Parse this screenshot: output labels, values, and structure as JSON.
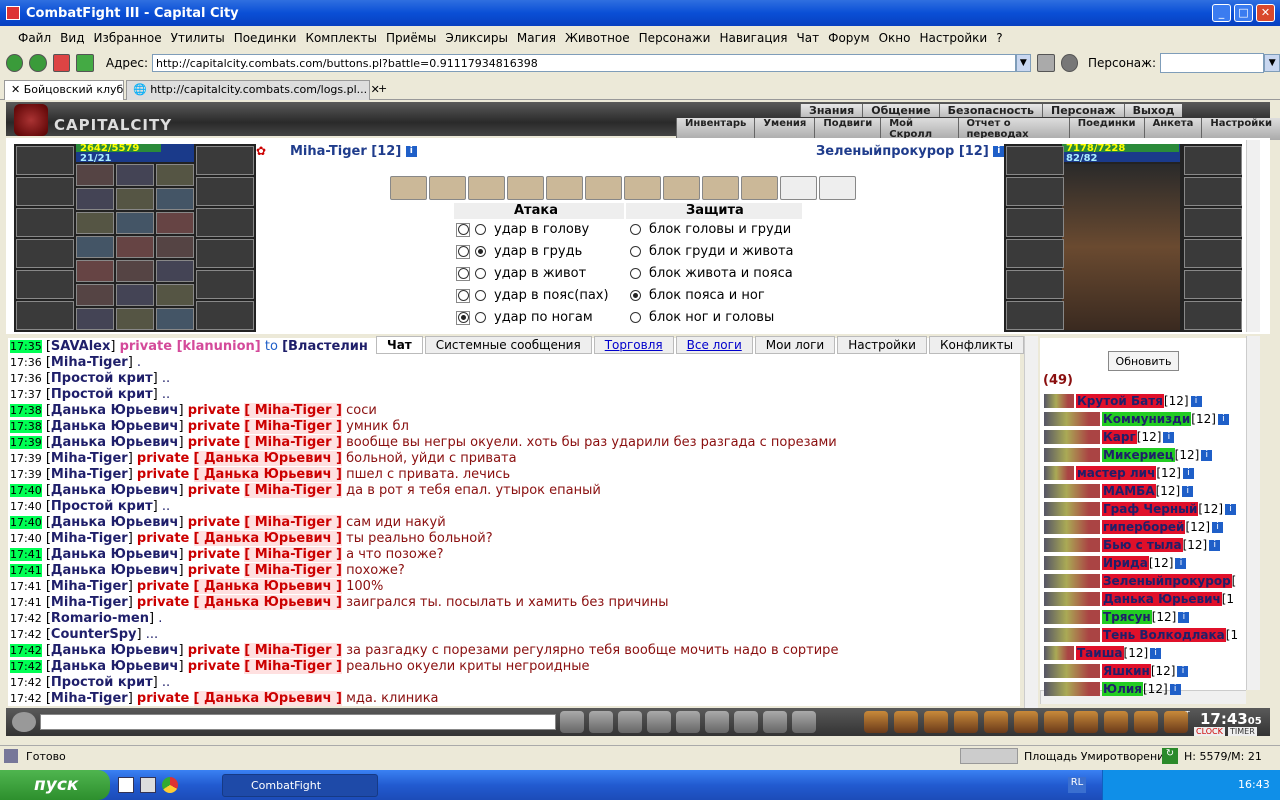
{
  "window": {
    "title": "CombatFight III - Capital City",
    "min": "_",
    "max": "□",
    "close": "✕"
  },
  "menu": [
    "Файл",
    "Вид",
    "Избранное",
    "Утилиты",
    "Поединки",
    "Комплекты",
    "Приёмы",
    "Эликсиры",
    "Магия",
    "Животное",
    "Персонажи",
    "Навигация",
    "Чат",
    "Форум",
    "Окно",
    "Настройки",
    "?"
  ],
  "address": {
    "label": "Адрес:",
    "value": "http://capitalcity.combats.com/buttons.pl?battle=0.91117934816398",
    "persona_label": "Персонаж:"
  },
  "tabs": [
    {
      "label": "Бойцовский клуб"
    },
    {
      "label": "http://capitalcity.combats.com/logs.pl..."
    }
  ],
  "game": {
    "logo": "CAPITALCITY",
    "nav1": [
      "Знания",
      "Общение",
      "Безопасность",
      "Персонаж",
      "Выход"
    ],
    "nav2": [
      "Инвентарь",
      "Умения",
      "Подвиги",
      "Мой Скролл",
      "Отчет о переводах",
      "Поединки",
      "Анкета",
      "Настройки"
    ]
  },
  "players": {
    "left": {
      "name": "Miha-Tiger [12]",
      "hp": "2642/5579",
      "mp": "21/21"
    },
    "right": {
      "name": "Зеленыйпрокурор [12]",
      "hp": "7178/7228",
      "mp": "82/82"
    }
  },
  "combat": {
    "attack_title": "Атака",
    "defense_title": "Защита",
    "attack": [
      {
        "label": "удар в голову",
        "on": false,
        "checked": false
      },
      {
        "label": "удар в грудь",
        "on": true,
        "checked": false
      },
      {
        "label": "удар в живот",
        "on": false,
        "checked": false
      },
      {
        "label": "удар в пояс(пах)",
        "on": false,
        "checked": false
      },
      {
        "label": "удар по ногам",
        "on": false,
        "checked": true
      }
    ],
    "defense": [
      {
        "label": "блок головы и груди",
        "on": false
      },
      {
        "label": "блок груди и живота",
        "on": false
      },
      {
        "label": "блок живота и пояса",
        "on": false
      },
      {
        "label": "блок пояса и ног",
        "on": true
      },
      {
        "label": "блок ног и головы",
        "on": false
      }
    ]
  },
  "chat_tabs": [
    {
      "label": "Чат",
      "style": "active"
    },
    {
      "label": "Системные сообщения",
      "style": ""
    },
    {
      "label": "Торговля",
      "style": "blue"
    },
    {
      "label": "Все логи",
      "style": "blue"
    },
    {
      "label": "Мои логи",
      "style": ""
    },
    {
      "label": "Настройки",
      "style": ""
    },
    {
      "label": "Конфликты",
      "style": ""
    }
  ],
  "chat": [
    {
      "t": "17:35",
      "hl": true,
      "nick": "SAVAlex",
      "priv": "private [klanunion]",
      "to": "to",
      "target": "[Властелин"
    },
    {
      "t": "17:36",
      "hl": false,
      "nick": "Miha-Tiger",
      "msg": "."
    },
    {
      "t": "17:36",
      "hl": false,
      "nick": "Простой крит",
      "msg": ".."
    },
    {
      "t": "17:37",
      "hl": false,
      "nick": "Простой крит",
      "msg": ".."
    },
    {
      "t": "17:38",
      "hl": true,
      "nick": "Данька Юрьевич",
      "priv": "private",
      "target": "[ Miha-Tiger ]",
      "msg": "соси"
    },
    {
      "t": "17:38",
      "hl": true,
      "nick": "Данька Юрьевич",
      "priv": "private",
      "target": "[ Miha-Tiger ]",
      "msg": "умник бл"
    },
    {
      "t": "17:39",
      "hl": true,
      "nick": "Данька Юрьевич",
      "priv": "private",
      "target": "[ Miha-Tiger ]",
      "msg": "вообще вы негры окуели. хоть бы раз ударили без разгада с порезами"
    },
    {
      "t": "17:39",
      "hl": false,
      "nick": "Miha-Tiger",
      "priv": "private",
      "target": "[ Данька Юрьевич ]",
      "msg": "больной, уйди с привата"
    },
    {
      "t": "17:39",
      "hl": false,
      "nick": "Miha-Tiger",
      "priv": "private",
      "target": "[ Данька Юрьевич ]",
      "msg": "пшел с привата. лечись"
    },
    {
      "t": "17:40",
      "hl": true,
      "nick": "Данька Юрьевич",
      "priv": "private",
      "target": "[ Miha-Tiger ]",
      "msg": "да в рот я тебя епал. утырок епаный"
    },
    {
      "t": "17:40",
      "hl": false,
      "nick": "Простой крит",
      "msg": ".."
    },
    {
      "t": "17:40",
      "hl": true,
      "nick": "Данька Юрьевич",
      "priv": "private",
      "target": "[ Miha-Tiger ]",
      "msg": "сам иди накуй"
    },
    {
      "t": "17:40",
      "hl": false,
      "nick": "Miha-Tiger",
      "priv": "private",
      "target": "[ Данька Юрьевич ]",
      "msg": "ты реально больной?"
    },
    {
      "t": "17:41",
      "hl": true,
      "nick": "Данька Юрьевич",
      "priv": "private",
      "target": "[ Miha-Tiger ]",
      "msg": "а что позоже?"
    },
    {
      "t": "17:41",
      "hl": true,
      "nick": "Данька Юрьевич",
      "priv": "private",
      "target": "[ Miha-Tiger ]",
      "msg": "похоже?"
    },
    {
      "t": "17:41",
      "hl": false,
      "nick": "Miha-Tiger",
      "priv": "private",
      "target": "[ Данька Юрьевич ]",
      "msg": "100%"
    },
    {
      "t": "17:41",
      "hl": false,
      "nick": "Miha-Tiger",
      "priv": "private",
      "target": "[ Данька Юрьевич ]",
      "msg": "заигрался ты. посылать и хамить без причины"
    },
    {
      "t": "17:42",
      "hl": false,
      "nick": "Romario-men",
      "msg": "."
    },
    {
      "t": "17:42",
      "hl": false,
      "nick": "CounterSpy",
      "msg": "..."
    },
    {
      "t": "17:42",
      "hl": true,
      "nick": "Данька Юрьевич",
      "priv": "private",
      "target": "[ Miha-Tiger ]",
      "msg": "за разгадку с порезами регулярно тебя вообще мочить надо в сортире"
    },
    {
      "t": "17:42",
      "hl": true,
      "nick": "Данька Юрьевич",
      "priv": "private",
      "target": "[ Miha-Tiger ]",
      "msg": "реально окуели криты негроидные"
    },
    {
      "t": "17:42",
      "hl": false,
      "nick": "Простой крит",
      "msg": ".."
    },
    {
      "t": "17:42",
      "hl": false,
      "nick": "Miha-Tiger",
      "priv": "private",
      "target": "[ Данька Юрьевич ]",
      "msg": "мда. клиника"
    }
  ],
  "userlist": {
    "refresh": "Обновить",
    "count": "(49)",
    "users": [
      {
        "name": "Крутой Батя",
        "lvl": "[12]",
        "style": "red",
        "indent": 30
      },
      {
        "name": "Коммунизди",
        "lvl": "[12]",
        "style": "green",
        "indent": 56
      },
      {
        "name": "Карг",
        "lvl": "[12]",
        "style": "red",
        "indent": 56
      },
      {
        "name": "Микериец",
        "lvl": "[12]",
        "style": "green",
        "indent": 56
      },
      {
        "name": "мастер лич",
        "lvl": "[12]",
        "style": "red",
        "indent": 30
      },
      {
        "name": "МАМБА",
        "lvl": "[12]",
        "style": "red",
        "indent": 56
      },
      {
        "name": "Граф Черный",
        "lvl": "[12]",
        "style": "red",
        "indent": 56
      },
      {
        "name": "гиперборей",
        "lvl": "[12]",
        "style": "red",
        "indent": 56
      },
      {
        "name": "Бью с тыла",
        "lvl": "[12]",
        "style": "red",
        "indent": 56
      },
      {
        "name": "Ирида",
        "lvl": "[12]",
        "style": "red",
        "indent": 56
      },
      {
        "name": "Зеленыйпрокурор",
        "lvl": "[",
        "style": "red",
        "indent": 56
      },
      {
        "name": "Данька Юрьевич",
        "lvl": "[1",
        "style": "red",
        "indent": 56
      },
      {
        "name": "Трясун",
        "lvl": "[12]",
        "style": "green",
        "indent": 56
      },
      {
        "name": "Тень Волкодлака",
        "lvl": "[1",
        "style": "red",
        "indent": 56
      },
      {
        "name": "Таиша",
        "lvl": "[12]",
        "style": "red",
        "indent": 30
      },
      {
        "name": "Яшкин",
        "lvl": "[12]",
        "style": "red",
        "indent": 56
      },
      {
        "name": "Юлия",
        "lvl": "[12]",
        "style": "green",
        "indent": 56
      }
    ]
  },
  "clock": {
    "time": "17:43",
    "sec": "05",
    "clock_label": "CLOCK",
    "timer_label": "TIMER",
    "exit": "EXIT"
  },
  "status": {
    "text": "Готово",
    "location": "Площадь Умиротворения",
    "hm": "H: 5579/M: 21"
  },
  "taskbar": {
    "start": "пуск",
    "item": "CombatFight",
    "lang": "RL",
    "time": "16:43"
  }
}
